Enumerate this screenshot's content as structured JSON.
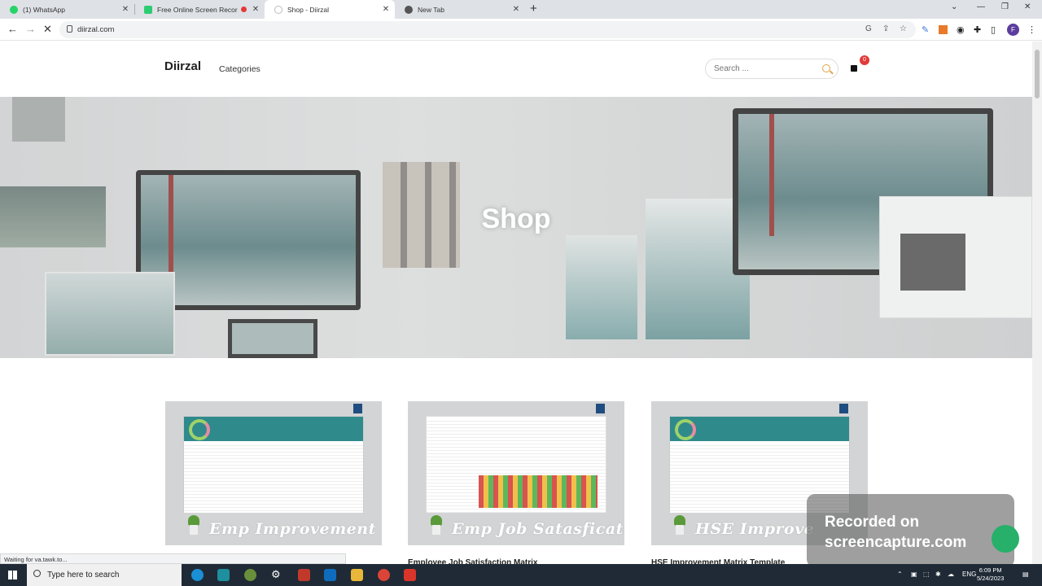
{
  "browser": {
    "tabs": [
      {
        "title": "(1) WhatsApp",
        "favicon_color": "#25d366"
      },
      {
        "title": "Free Online Screen Recorder",
        "favicon_color": "#2ecc71"
      },
      {
        "title": "Shop - Diirzal",
        "favicon_color": "#cfcfcf"
      },
      {
        "title": "New Tab",
        "favicon_color": "#555555"
      }
    ],
    "url": "diirzal.com",
    "profile_initial": "F"
  },
  "site": {
    "logo": "Diirzal",
    "nav_categories": "Categories",
    "search_placeholder": "Search ...",
    "cart_count": "0",
    "hero_title": "Shop"
  },
  "products": [
    {
      "label": "Emp Improvement",
      "title": ""
    },
    {
      "label": "Emp Job Satasfication",
      "title": "Employee Job Satisfaction Matrix"
    },
    {
      "label": "HSE Improve",
      "title": "HSE Improvement Matrix Template"
    }
  ],
  "status_text": "Waiting for va.tawk.to...",
  "watermark": {
    "line1": "Recorded on",
    "line2": "screencapture.com"
  },
  "taskbar": {
    "search_text": "Type here to search",
    "language": "ENG",
    "time": "6:09 PM",
    "date": "5/24/2023"
  },
  "colors": {
    "accent": "#e0a44a",
    "badge": "#e23a3a",
    "teal": "#2f8a8c"
  }
}
